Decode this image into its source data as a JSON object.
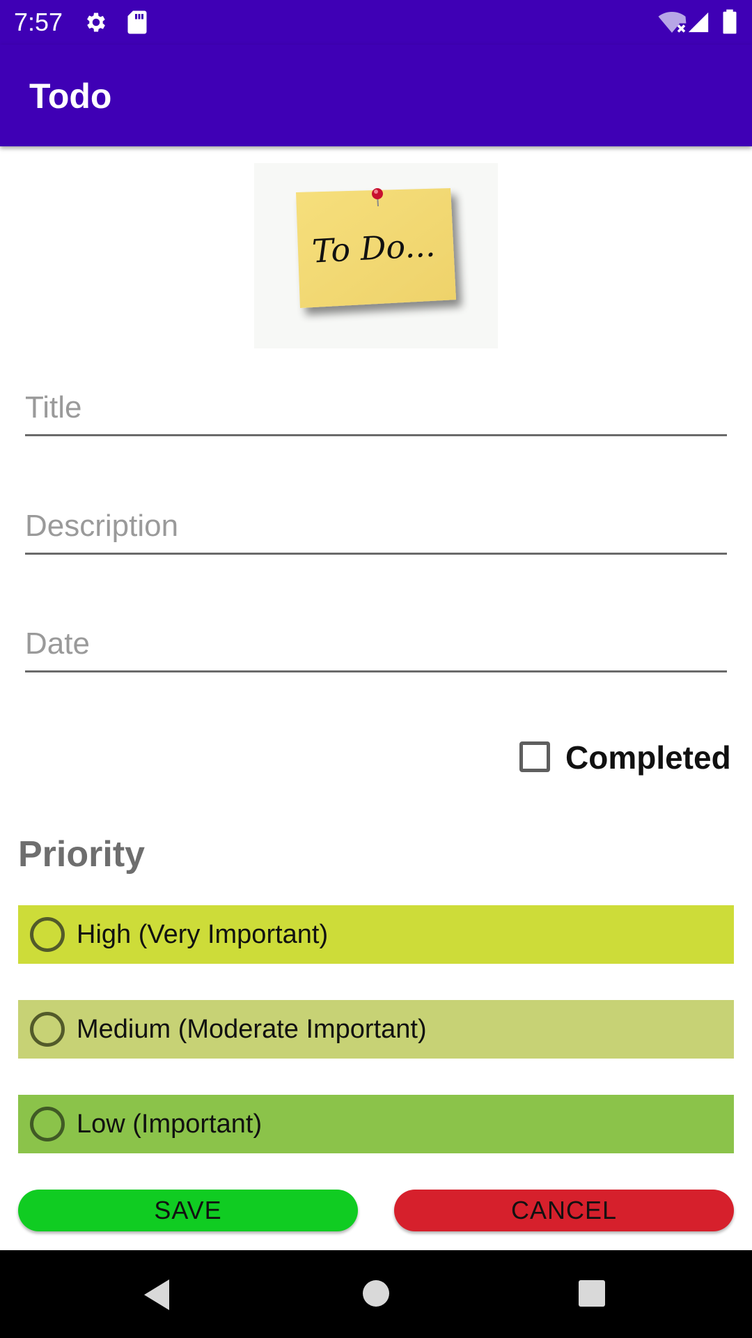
{
  "status_bar": {
    "time": "7:57",
    "icons": [
      "gear-icon",
      "sd-card-icon",
      "wifi-off-icon",
      "signal-icon",
      "battery-icon"
    ],
    "background": "#3f00b5"
  },
  "app_bar": {
    "title": "Todo",
    "background": "#3f00b5"
  },
  "image": {
    "text": "To Do..."
  },
  "form": {
    "title_placeholder": "Title",
    "description_placeholder": "Description",
    "date_placeholder": "Date",
    "completed_label": "Completed",
    "completed_checked": false
  },
  "priority": {
    "heading": "Priority",
    "options": [
      {
        "label": "High (Very Important)",
        "color": "#cddc39",
        "selected": false
      },
      {
        "label": "Medium (Moderate Important)",
        "color": "#c7d275",
        "selected": false
      },
      {
        "label": "Low (Important)",
        "color": "#8bc34a",
        "selected": false
      }
    ]
  },
  "buttons": {
    "save_label": "SAVE",
    "save_color": "#10cc22",
    "cancel_label": "CANCEL",
    "cancel_color": "#d6202c"
  },
  "nav_bar": {
    "icons": [
      "back-icon",
      "home-icon",
      "recents-icon"
    ]
  }
}
